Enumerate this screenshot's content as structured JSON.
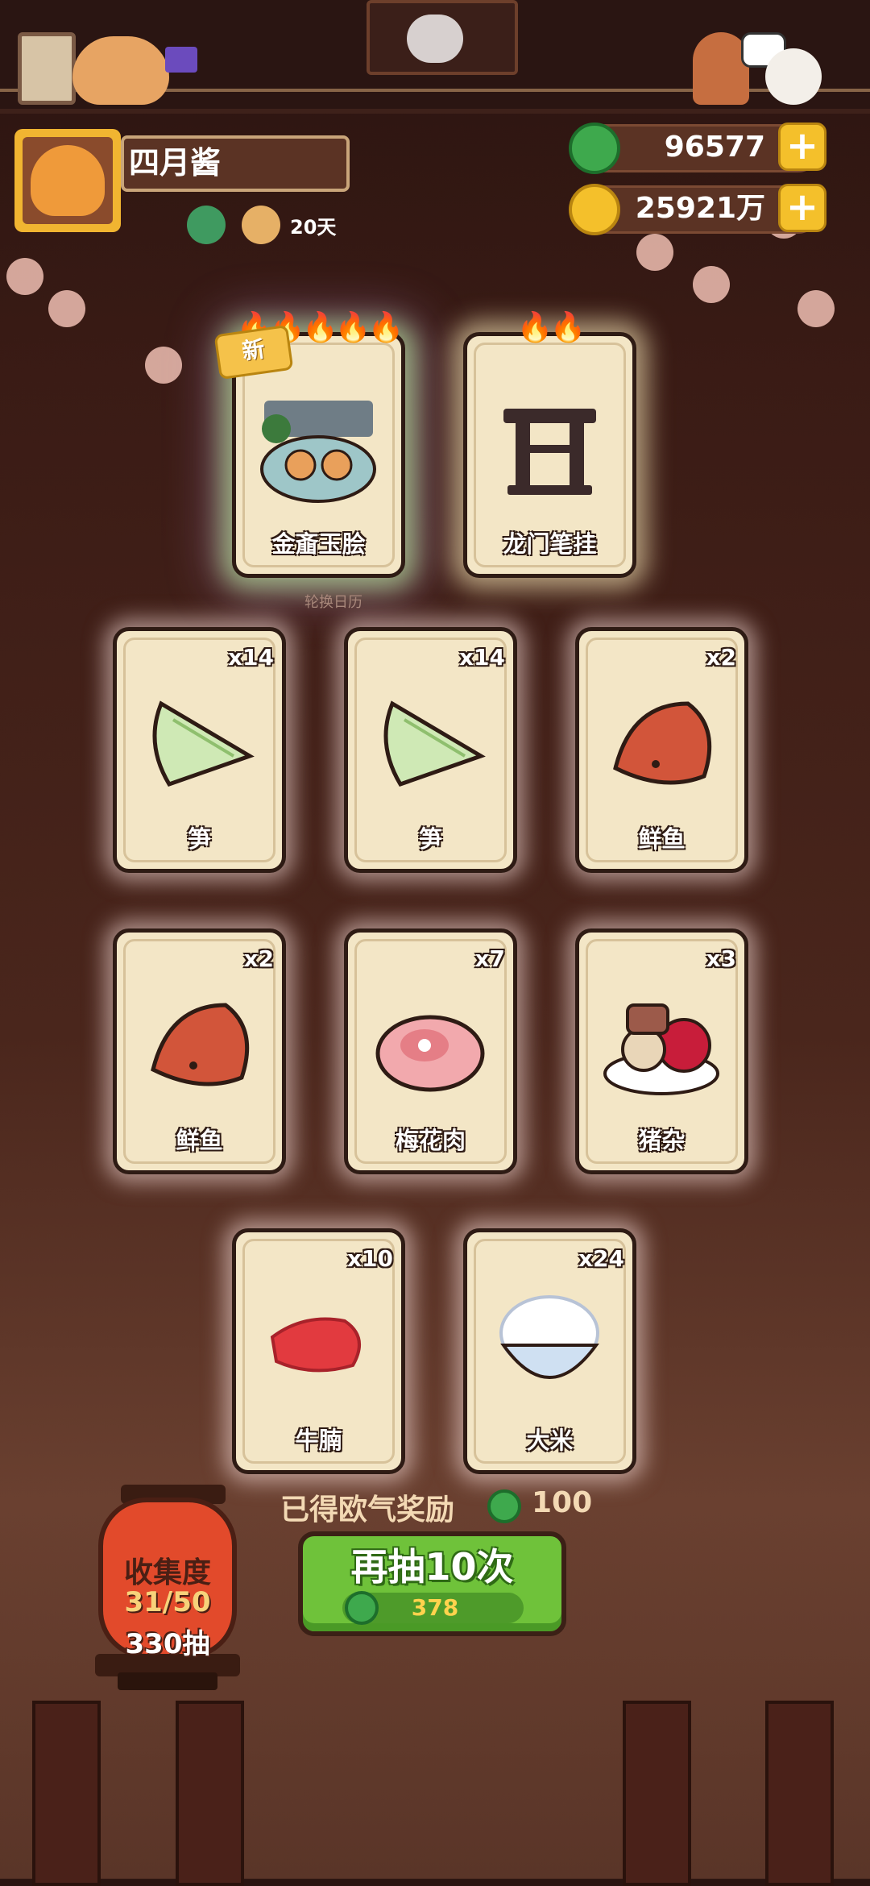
{
  "top_bar": {
    "collection_book_icon": "paw-book-icon",
    "sign_icon": "grandpa-cat-sign-icon"
  },
  "profile": {
    "name": "四月酱",
    "days": "20天"
  },
  "currency": {
    "jade": "96577",
    "coins": "25921万",
    "jade_color": "#3ea94d",
    "coin_color": "#f4c02b"
  },
  "cards": [
    {
      "label": "金齑玉脍",
      "flames": "🔥🔥🔥🔥🔥",
      "new_tag": "新",
      "art": "dish-platter-icon",
      "qty": ""
    },
    {
      "label": "龙门笔挂",
      "flames": "🔥🔥",
      "new_tag": "",
      "art": "brush-rack-icon",
      "qty": ""
    },
    {
      "label": "笋",
      "qty": "x14",
      "art": "bamboo-shoot-icon"
    },
    {
      "label": "笋",
      "qty": "x14",
      "art": "bamboo-shoot-icon"
    },
    {
      "label": "鲜鱼",
      "qty": "x2",
      "art": "fish-icon"
    },
    {
      "label": "鲜鱼",
      "qty": "x2",
      "art": "fish-icon"
    },
    {
      "label": "梅花肉",
      "qty": "x7",
      "art": "pork-icon"
    },
    {
      "label": "猪杂",
      "qty": "x3",
      "art": "offal-icon"
    },
    {
      "label": "牛腩",
      "qty": "x10",
      "art": "beef-icon"
    },
    {
      "label": "大米",
      "qty": "x24",
      "art": "rice-bowl-icon"
    }
  ],
  "rotation_caption": "轮换日历",
  "reward": {
    "text": "已得欧气奖励",
    "value": "100"
  },
  "draw_button": {
    "label": "再抽10次",
    "cost": "378"
  },
  "collection": {
    "title": "收集度",
    "progress": "31/50",
    "draws": "330抽"
  }
}
